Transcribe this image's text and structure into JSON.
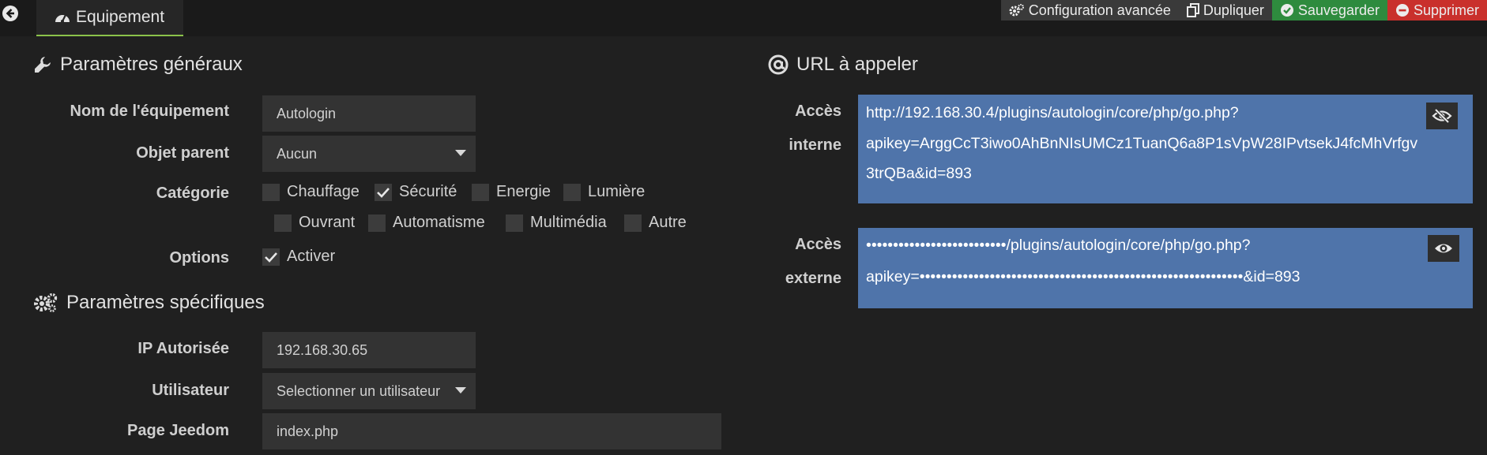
{
  "header": {
    "tab_label": "Equipement",
    "actions": {
      "advanced": "Configuration avancée",
      "duplicate": "Dupliquer",
      "save": "Sauvegarder",
      "delete": "Supprimer"
    }
  },
  "general": {
    "title": "Paramètres généraux",
    "name_label": "Nom de l'équipement",
    "name_value": "Autologin",
    "parent_label": "Objet parent",
    "parent_value": "Aucun",
    "category_label": "Catégorie",
    "categories": [
      {
        "label": "Chauffage",
        "checked": false
      },
      {
        "label": "Sécurité",
        "checked": true
      },
      {
        "label": "Energie",
        "checked": false
      },
      {
        "label": "Lumière",
        "checked": false
      },
      {
        "label": "Ouvrant",
        "checked": false
      },
      {
        "label": "Automatisme",
        "checked": false
      },
      {
        "label": "Multimédia",
        "checked": false
      },
      {
        "label": "Autre",
        "checked": false
      }
    ],
    "options_label": "Options",
    "activate_label": "Activer",
    "activate_checked": true
  },
  "specific": {
    "title": "Paramètres spécifiques",
    "ip_label": "IP Autorisée",
    "ip_value": "192.168.30.65",
    "user_label": "Utilisateur",
    "user_value": "Selectionner un utilisateur",
    "page_label": "Page Jeedom",
    "page_value": "index.php"
  },
  "urls": {
    "title": "URL à appeler",
    "internal": {
      "label_line1": "Accès",
      "label_line2": "interne",
      "line1": "http://192.168.30.4/plugins/autologin/core/php/go.php?",
      "line2": "apikey=ArggCcT3iwo0AhBnNIsUMCz1TuanQ6a8P1sVpW28IPvtsekJ4fcMhVrfgv",
      "line3": "3trQBa&id=893"
    },
    "external": {
      "label_line1": "Accès",
      "label_line2": "externe",
      "line1": "••••••••••••••••••••••••••/plugins/autologin/core/php/go.php?",
      "line2": "apikey=••••••••••••••••••••••••••••••••••••••••••••••••••••••••••••&id=893"
    }
  },
  "colors": {
    "background": "#202020",
    "accent_green": "#8bc34a",
    "save": "#2e8b3e",
    "delete": "#c9302c",
    "url_box": "#4f74aa"
  }
}
